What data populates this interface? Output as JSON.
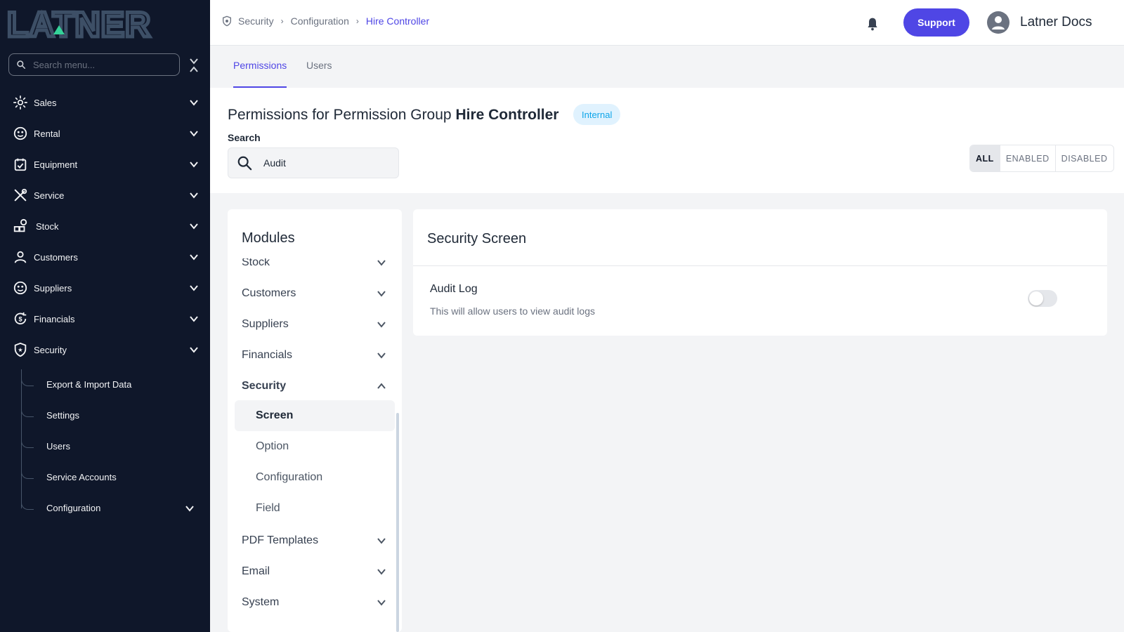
{
  "app": {
    "logo_text": "LATNER"
  },
  "sidebar": {
    "search_placeholder": "Search menu...",
    "items": [
      {
        "label": "Sales",
        "icon": "sales-icon"
      },
      {
        "label": "Rental",
        "icon": "rental-icon"
      },
      {
        "label": "Equipment",
        "icon": "equipment-icon"
      },
      {
        "label": "Service",
        "icon": "service-icon"
      },
      {
        "label": "Stock",
        "icon": "stock-icon"
      },
      {
        "label": "Customers",
        "icon": "customers-icon"
      },
      {
        "label": "Suppliers",
        "icon": "suppliers-icon"
      },
      {
        "label": "Financials",
        "icon": "financials-icon"
      },
      {
        "label": "Security",
        "icon": "security-icon"
      }
    ],
    "security_children": [
      {
        "label": "Export & Import Data"
      },
      {
        "label": "Settings"
      },
      {
        "label": "Users"
      },
      {
        "label": "Service Accounts"
      },
      {
        "label": "Configuration"
      }
    ]
  },
  "header": {
    "breadcrumb": [
      "Security",
      "Configuration",
      "Hire Controller"
    ],
    "support_label": "Support",
    "user_name": "Latner Docs"
  },
  "tabs": [
    {
      "label": "Permissions",
      "active": true
    },
    {
      "label": "Users",
      "active": false
    }
  ],
  "page": {
    "title_prefix": "Permissions for Permission Group",
    "title_group": "Hire Controller",
    "badge": "Internal",
    "search_label": "Search",
    "search_value": "Audit",
    "filters": [
      "ALL",
      "ENABLED",
      "DISABLED"
    ],
    "active_filter": "ALL"
  },
  "modules": {
    "title": "Modules",
    "items": [
      "Stock",
      "Customers",
      "Suppliers",
      "Financials",
      "Security"
    ],
    "security_children": [
      "Screen",
      "Option",
      "Configuration",
      "Field"
    ],
    "active_child": "Screen",
    "items_after": [
      "PDF Templates",
      "Email",
      "System"
    ]
  },
  "screen": {
    "title": "Security Screen",
    "permissions": [
      {
        "name": "Audit Log",
        "description": "This will allow users to view audit logs",
        "enabled": false
      }
    ]
  },
  "colors": {
    "accent": "#4f46e5",
    "sidebar_bg": "#0f172a",
    "badge_bg": "#e0f2fe",
    "badge_fg": "#0ea5e9"
  }
}
